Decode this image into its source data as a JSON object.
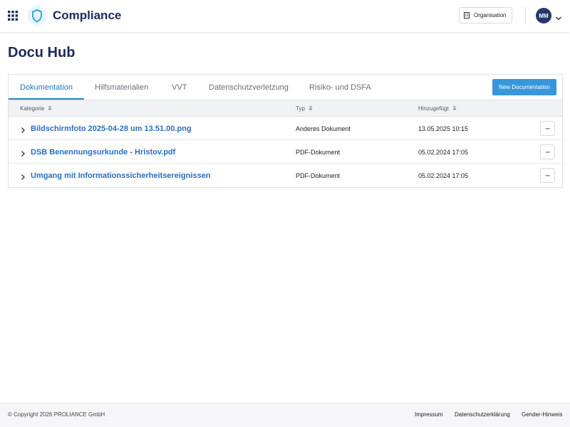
{
  "header": {
    "app_title": "Compliance",
    "organisation_label": "Organisation",
    "avatar_initials": "MM",
    "brand_color": "#1d2a5a",
    "logo_color": "#2a9fd6"
  },
  "page": {
    "title": "Docu Hub"
  },
  "tabs": [
    {
      "label": "Dokumentation",
      "active": true
    },
    {
      "label": "Hilfsmaterialien",
      "active": false
    },
    {
      "label": "VVT",
      "active": false
    },
    {
      "label": "Datenschutzverletzung",
      "active": false
    },
    {
      "label": "Risiko- und DSFA",
      "active": false
    }
  ],
  "actions": {
    "new_documentation": "New Documentation",
    "accent_color": "#3897da"
  },
  "table": {
    "columns": [
      "Kategorie",
      "Typ",
      "Hinzugefügt"
    ],
    "rows": [
      {
        "name": "Bildschirmfoto 2025-04-28 um 13.51.00.png",
        "type": "Anderes Dokument",
        "added": "13.05.2025 10:15",
        "actions": "···"
      },
      {
        "name": "DSB Benennungsurkunde - Hristov.pdf",
        "type": "PDF-Dokument",
        "added": "05.02.2024 17:05",
        "actions": "···"
      },
      {
        "name": "Umgang mit Informationssicherheitsereignissen",
        "type": "PDF-Dokument",
        "added": "05.02.2024 17:05",
        "actions": "···"
      }
    ]
  },
  "footer": {
    "copyright": "© Copyright 2026 PROLIANCE GmbH",
    "links": [
      "Impressum",
      "Datenschutzerklärung",
      "Gender-Hinweis"
    ]
  }
}
